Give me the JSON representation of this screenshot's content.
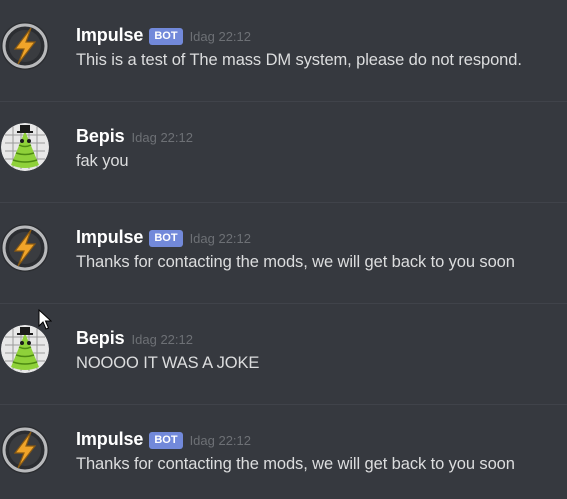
{
  "messages": [
    {
      "author": "Impulse",
      "bot_tag": "BOT",
      "timestamp": "Idag 22:12",
      "text": "This is a test of The mass DM system, please do not respond.",
      "avatar_icon": "impulse-lightning-icon"
    },
    {
      "author": "Bepis",
      "bot_tag": "",
      "timestamp": "Idag 22:12",
      "text": "fak you",
      "avatar_icon": "bepis-character-icon"
    },
    {
      "author": "Impulse",
      "bot_tag": "BOT",
      "timestamp": "Idag 22:12",
      "text": "Thanks for contacting the mods, we will get back to you soon",
      "avatar_icon": "impulse-lightning-icon"
    },
    {
      "author": "Bepis",
      "bot_tag": "",
      "timestamp": "Idag 22:12",
      "text": "NOOOO IT WAS A JOKE",
      "avatar_icon": "bepis-character-icon"
    },
    {
      "author": "Impulse",
      "bot_tag": "BOT",
      "timestamp": "Idag 22:12",
      "text": "Thanks for contacting the mods, we will get back to you soon",
      "avatar_icon": "impulse-lightning-icon"
    }
  ],
  "colors": {
    "background": "#36393f",
    "username": "#ffffff",
    "message_text": "#dcddde",
    "timestamp": "#6d7075",
    "bot_tag": "#7289da",
    "divider": "#40434a"
  }
}
